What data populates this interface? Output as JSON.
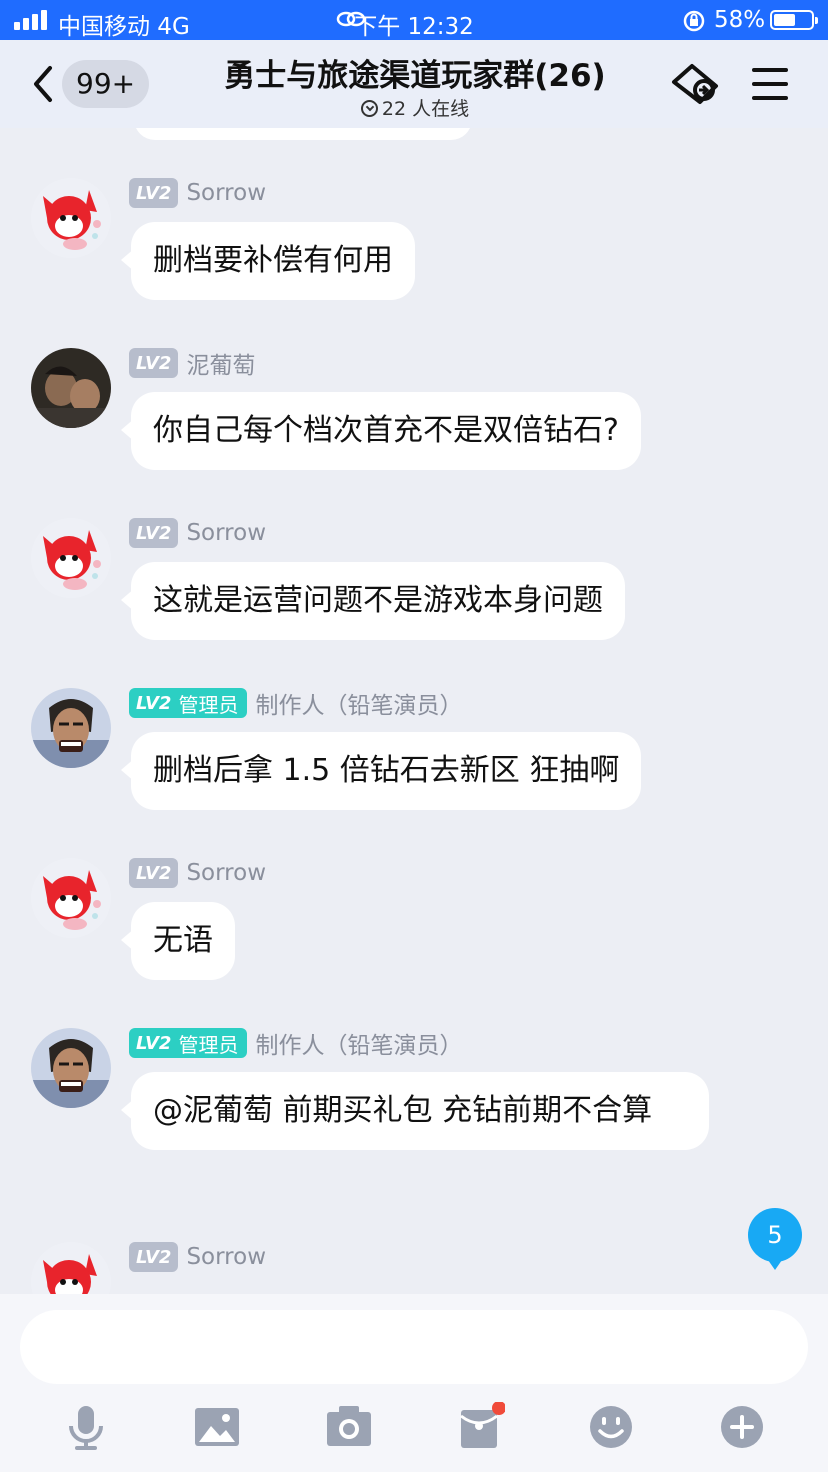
{
  "status_bar": {
    "carrier": "中国移动  4G",
    "time": "下午 12:32",
    "battery": "58%",
    "battery_level": 0.58
  },
  "header": {
    "unread_badge": "99+",
    "title": "勇士与旅途渠道玩家群(26)",
    "online": "22 人在线"
  },
  "messages": [
    {
      "level": "LV2",
      "role": "",
      "name": "Sorrow",
      "text": "删档要补偿有何用",
      "avatar": "red-fox-avatar"
    },
    {
      "level": "LV2",
      "role": "",
      "name": "泥葡萄",
      "text": "你自己每个档次首充不是双倍钻石?",
      "avatar": "photo-avatar"
    },
    {
      "level": "LV2",
      "role": "",
      "name": "Sorrow",
      "text": "这就是运营问题不是游戏本身问题",
      "avatar": "red-fox-avatar"
    },
    {
      "level": "LV2",
      "role": "管理员",
      "name": "制作人（铅笔演员）",
      "text": "删档后拿 1.5 倍钻石去新区 狂抽啊",
      "avatar": "cartoon-man-avatar"
    },
    {
      "level": "LV2",
      "role": "",
      "name": "Sorrow",
      "text": "无语",
      "avatar": "red-fox-avatar"
    },
    {
      "level": "LV2",
      "role": "管理员",
      "name": "制作人（铅笔演员）",
      "text": "@泥葡萄 前期买礼包 充钻前期不合算",
      "avatar": "cartoon-man-avatar"
    },
    {
      "level": "LV2",
      "role": "",
      "name": "Sorrow",
      "text": "",
      "avatar": "red-fox-avatar"
    }
  ],
  "new_messages_count": "5",
  "toolbar": [
    "microphone-icon",
    "image-icon",
    "camera-icon",
    "red-packet-icon",
    "emoji-icon",
    "plus-icon"
  ],
  "colors": {
    "status_bar": "#1f6cff",
    "admin_badge": "#2ccfc3",
    "level_badge": "#b7bdcc",
    "unread": "#18a9f4"
  }
}
